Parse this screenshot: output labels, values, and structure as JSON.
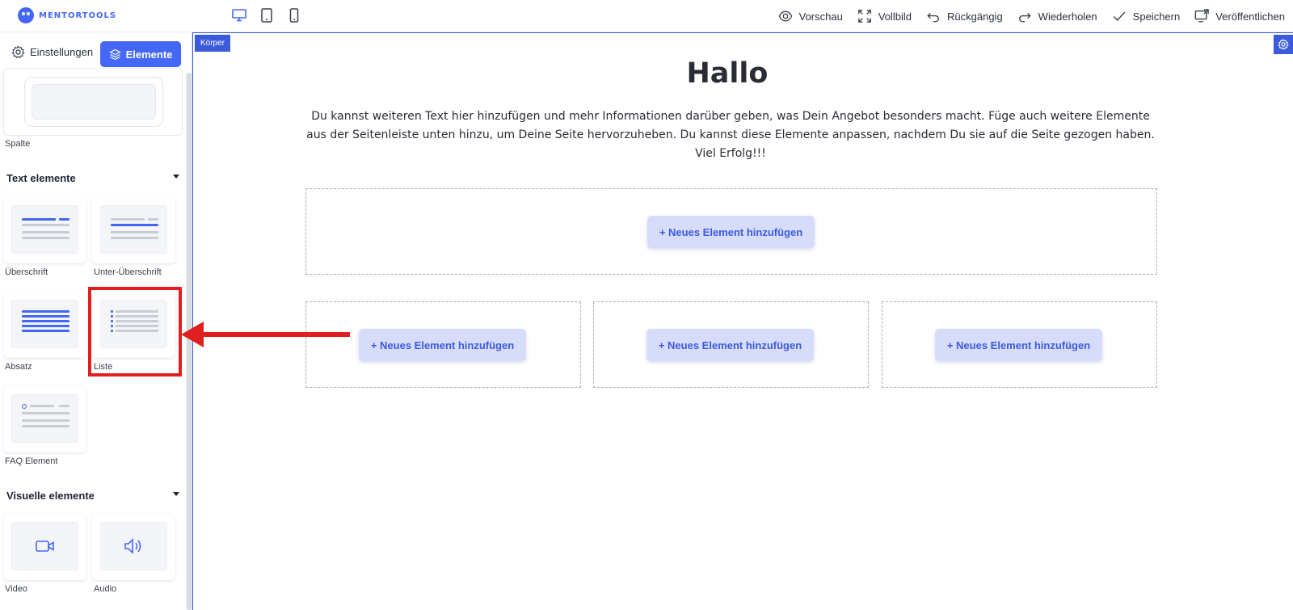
{
  "brand": {
    "logo_text": "MENTORTOOLS",
    "accent_color": "#4468f5"
  },
  "toolbar": {
    "devices": [
      {
        "icon": "desktop-icon",
        "active": true
      },
      {
        "icon": "tablet-icon",
        "active": false
      },
      {
        "icon": "mobile-icon",
        "active": false
      }
    ],
    "actions": [
      {
        "label": "Vorschau",
        "icon": "eye-icon"
      },
      {
        "label": "Vollbild",
        "icon": "fullscreen-icon"
      },
      {
        "label": "Rückgängig",
        "icon": "undo-icon"
      },
      {
        "label": "Wiederholen",
        "icon": "redo-icon"
      },
      {
        "label": "Speichern",
        "icon": "check-icon"
      },
      {
        "label": "Veröffentlichen",
        "icon": "publish-icon"
      }
    ]
  },
  "sidebar": {
    "tabs": {
      "settings": "Einstellungen",
      "elements": "Elemente"
    },
    "layout_items": [
      {
        "label": "Spalte"
      }
    ],
    "sections": [
      {
        "title": "Text elemente",
        "items": [
          {
            "label": "Überschrift"
          },
          {
            "label": "Unter-Überschrift"
          },
          {
            "label": "Absatz"
          },
          {
            "label": "Liste"
          },
          {
            "label": "FAQ Element"
          }
        ]
      },
      {
        "title": "Visuelle elemente",
        "items": [
          {
            "label": "Video"
          },
          {
            "label": "Audio"
          }
        ]
      }
    ]
  },
  "canvas": {
    "body_badge": "Körper",
    "title": "Hallo",
    "text": "Du kannst weiteren Text hier hinzufügen und mehr Informationen darüber geben, was Dein Angebot besonders macht. Füge auch weitere Elemente aus der Seitenleiste unten hinzu, um Deine Seite hervorzuheben. Du kannst diese Elemente anpassen, nachdem Du sie auf die Seite gezogen haben. Viel Erfolg!!!",
    "add_element_label": "+ Neues Element hinzufügen",
    "annotation_color": "#e0201e"
  }
}
